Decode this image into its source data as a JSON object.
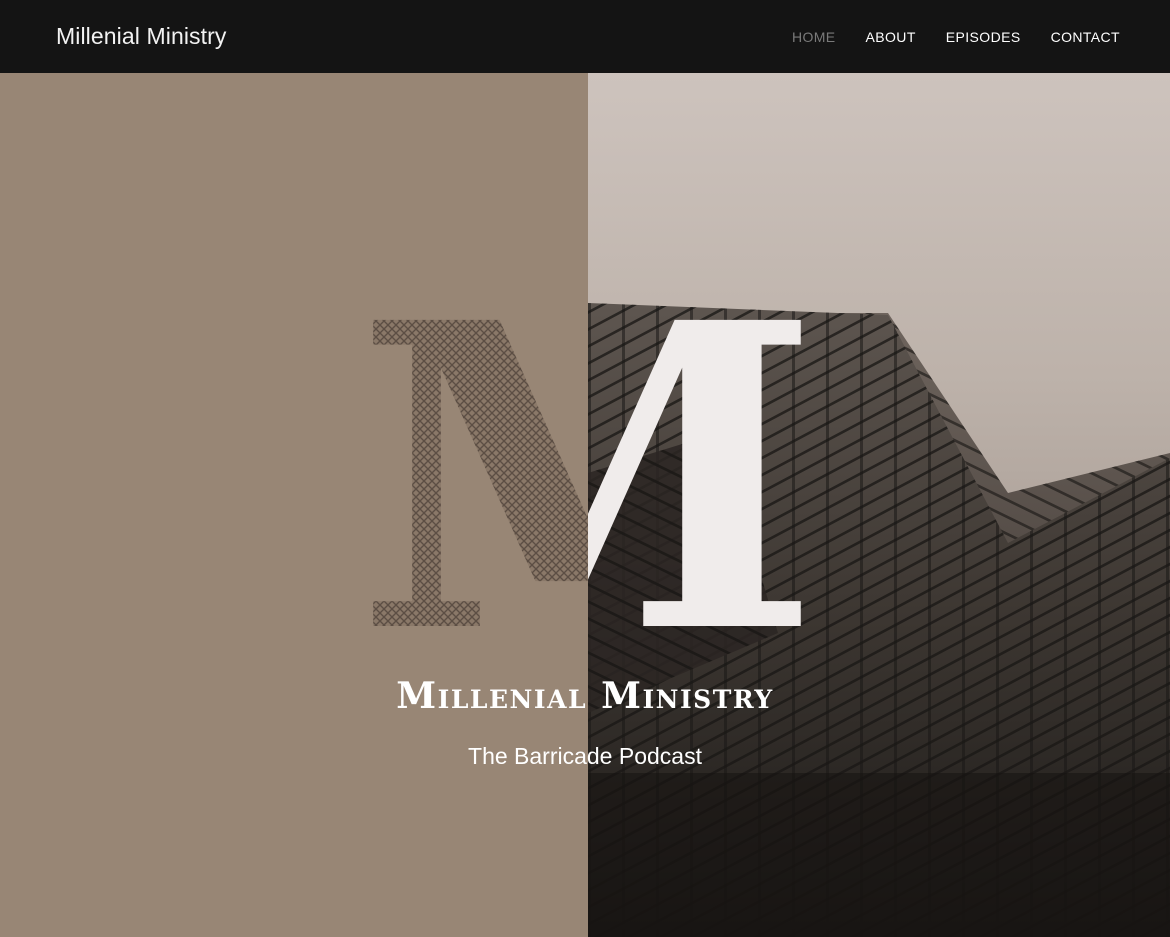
{
  "navbar": {
    "brand": "Millenial Ministry",
    "links": [
      {
        "label": "HOME",
        "active": true
      },
      {
        "label": "ABOUT",
        "active": false
      },
      {
        "label": "EPISODES",
        "active": false
      },
      {
        "label": "CONTACT",
        "active": false
      }
    ]
  },
  "hero": {
    "monogram_letter": "M",
    "title": "Millenial Ministry",
    "subtitle": "The Barricade Podcast"
  },
  "colors": {
    "navbar_bg": "#141414",
    "hero_left_bg": "#988675",
    "monogram_fill": "#f0eceb",
    "text_light": "#ffffff",
    "nav_active": "#7a7a7a"
  }
}
